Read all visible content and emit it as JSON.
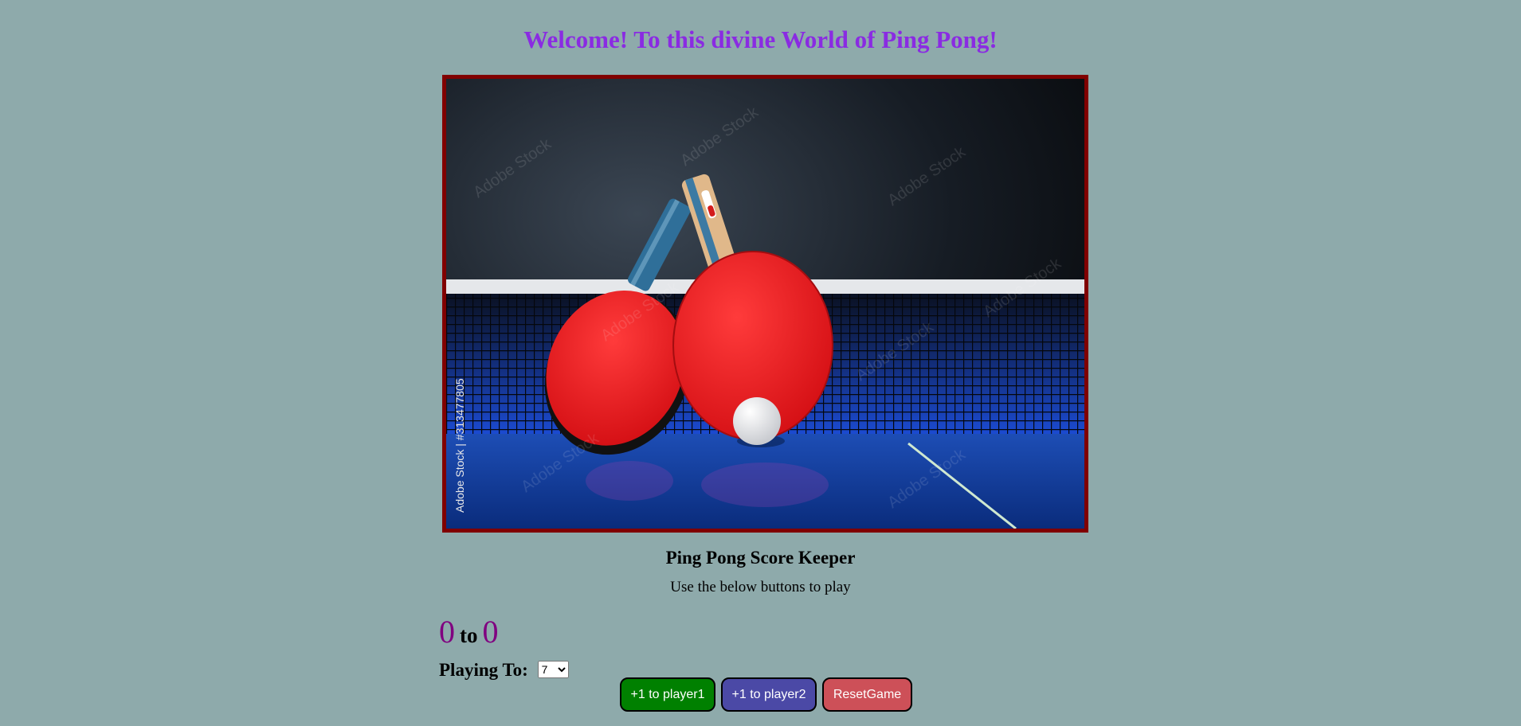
{
  "page": {
    "welcome_heading": "Welcome! To this divine World of Ping Pong!",
    "hero_image": {
      "description_icon": "ping-pong-paddles-image",
      "watermark_text": "Adobe Stock | #313477805",
      "watermark_repeat": "Adobe Stock"
    },
    "title": "Ping Pong Score Keeper",
    "instructions": "Use the below buttons to play",
    "score": {
      "player1": "0",
      "separator": "to",
      "player2": "0"
    },
    "playing_to": {
      "label": "Playing To:",
      "selected": "7"
    },
    "buttons": {
      "player1": "+1 to player1",
      "player2": "+1 to player2",
      "reset": "ResetGame"
    }
  },
  "colors": {
    "background": "#8eaaab",
    "heading": "#8a2be2",
    "image_border": "#800000",
    "score_number": "#800080",
    "player1_button": "#008000",
    "player2_button": "#4b49a6",
    "reset_button": "#cd5058"
  }
}
